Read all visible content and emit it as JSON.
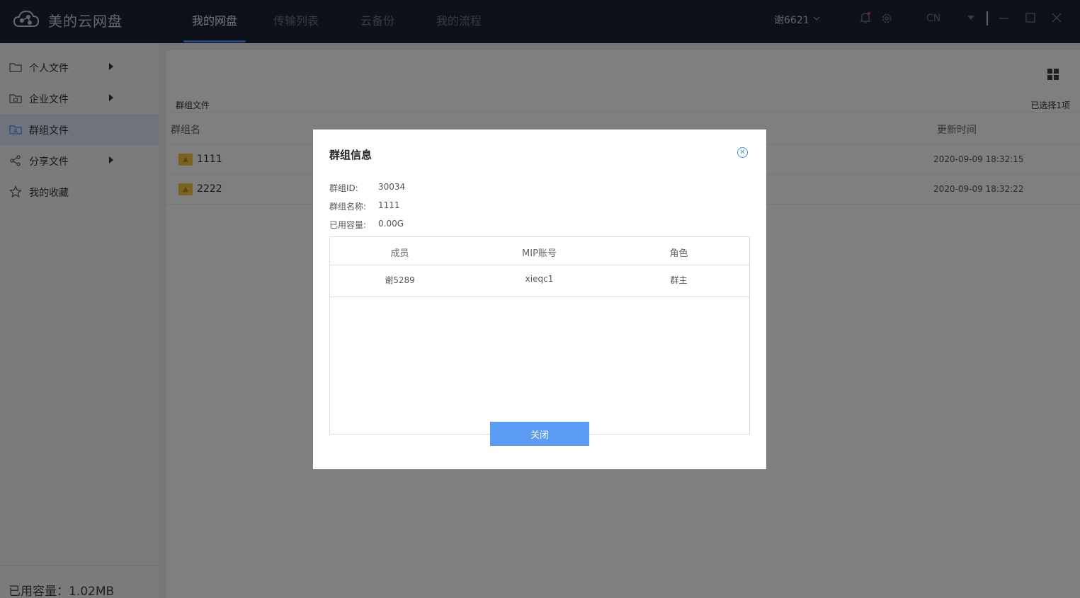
{
  "app": {
    "title": "美的云网盘"
  },
  "nav": {
    "tabs": [
      {
        "label": "我的网盘"
      },
      {
        "label": "传输列表"
      },
      {
        "label": "云备份"
      },
      {
        "label": "我的流程"
      }
    ]
  },
  "header": {
    "user": "谢6621",
    "lang": "CN",
    "icons": [
      "bell-icon",
      "gear-icon",
      "chevron-down-icon",
      "minimize-icon",
      "maximize-icon",
      "close-icon"
    ]
  },
  "sidebar": {
    "items": [
      {
        "label": "个人文件",
        "icon": "folder-icon"
      },
      {
        "label": "企业文件",
        "icon": "enterprise-folder-icon"
      },
      {
        "label": "群组文件",
        "icon": "group-folder-icon"
      },
      {
        "label": "分享文件",
        "icon": "share-icon"
      },
      {
        "label": "我的收藏",
        "icon": "star-icon"
      }
    ],
    "usage": "已用容量：1.02MB"
  },
  "main": {
    "breadcrumb": "群组文件",
    "selected": "已选择1项",
    "columns": {
      "name": "群组名",
      "updated": "更新时间"
    },
    "rows": [
      {
        "name": "1111",
        "updated": "2020-09-09 18:32:15"
      },
      {
        "name": "2222",
        "updated": "2020-09-09 18:32:22"
      }
    ]
  },
  "dialog": {
    "title": "群组信息",
    "id_label": "群组ID:",
    "id_value": "30034",
    "name_label": "群组名称:",
    "name_value": "1111",
    "capacity_label": "已用容量:",
    "capacity_value": "0.00G",
    "columns": {
      "member": "成员",
      "account": "MIP账号",
      "role": "角色"
    },
    "members": [
      {
        "member": "谢5289",
        "account": "xieqc1",
        "role": "群主"
      }
    ],
    "close_label": "关闭"
  },
  "colors": {
    "accent": "#4a8ef0",
    "titlebar": "#1a2233",
    "button": "#5b9bf3",
    "folder": "#f4c542"
  }
}
